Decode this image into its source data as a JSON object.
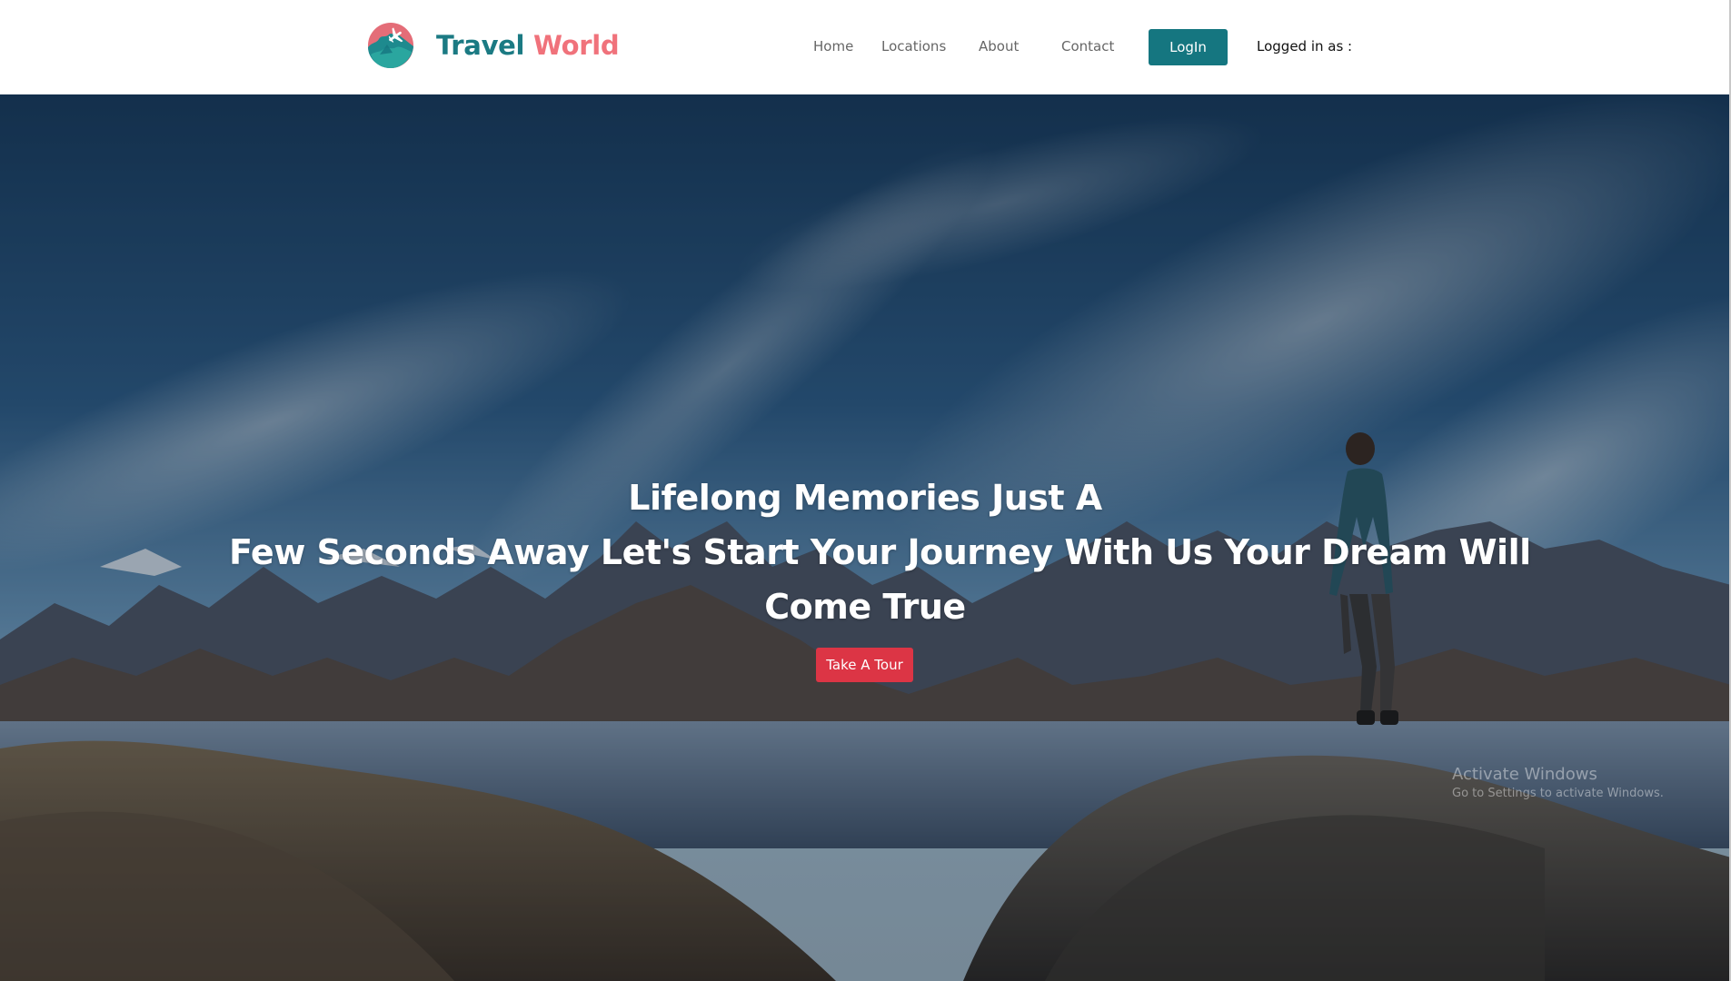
{
  "header": {
    "brand": {
      "part1": "Travel",
      "part2": "World",
      "logo_icon": "globe-airplane-icon"
    },
    "nav": {
      "home": "Home",
      "locations": "Locations",
      "about": "About",
      "contact": "Contact"
    },
    "login_label": "LogIn",
    "logged_in_text": "Logged in as :"
  },
  "hero": {
    "headline_lines": [
      "Lifelong Memories Just A",
      "Few Seconds Away Let's Start Your Journey With Us Your Dream Will",
      "Come True"
    ],
    "cta_label": "Take A Tour"
  },
  "watermark": {
    "title": "Activate Windows",
    "subtitle": "Go to Settings to activate Windows."
  },
  "colors": {
    "brand_primary": "#157680",
    "brand_accent": "#f0727b",
    "cta": "#dc3545"
  }
}
